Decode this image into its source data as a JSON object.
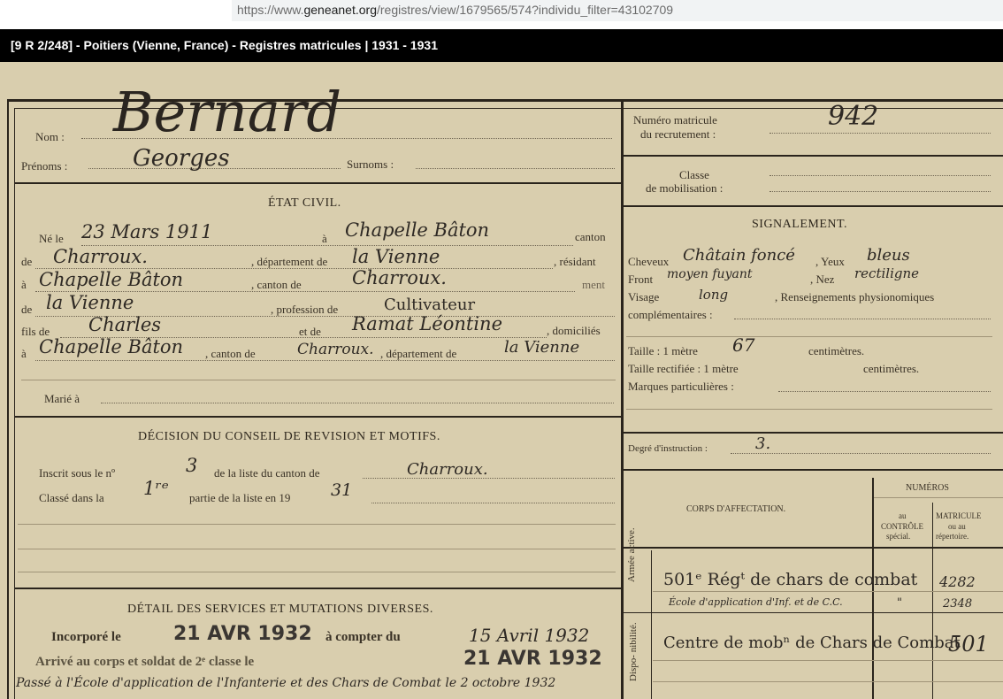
{
  "browser": {
    "url_prefix": "https://www.",
    "url_domain": "geneanet.org",
    "url_path": "/registres/view/1679565/574?individu_filter=43102709"
  },
  "viewer": {
    "title": "[9 R 2/248] - Poitiers (Vienne, France) - Registres matricules | 1931 - 1931"
  },
  "record": {
    "labels": {
      "nom": "Nom :",
      "prenoms": "Prénoms :",
      "surnoms": "Surnoms :",
      "etat_civil": "ÉTAT CIVIL.",
      "ne_le": "Né le",
      "a": "à",
      "canton": "canton",
      "de": "de",
      "departement_de": ", département de",
      "residant": ", résidant",
      "a2": "à",
      "canton_de": ", canton de",
      "ment": "ment",
      "de2": "de",
      "profession_de": ", profession de",
      "fils_de": "fils de",
      "et_de": "et de",
      "domicilies": ", domiciliés",
      "a3": "à",
      "canton_de2": ", canton de",
      "departement_de2": ", département de",
      "marie_a": "Marié à",
      "decision": "DÉCISION  DU CONSEIL DE REVISION ET MOTIFS.",
      "inscrit": "Inscrit sous le nº",
      "de_la_liste": "de la liste du canton de",
      "classe_dans": "Classé dans   la",
      "partie": "partie de la liste en 19",
      "detail": "DÉTAIL DES SERVICES ET MUTATIONS DIVERSES.",
      "incorpore": "Incorporé le",
      "a_compter": "à  compter  du",
      "arrive": "Arrivé au corps et soldat de 2ᵉ classe le",
      "numero_matricule": "Numéro matricule",
      "du_recrutement": "du recrutement :",
      "classe": "Classe",
      "de_mobilisation": "de mobilisation :",
      "signalement": "SIGNALEMENT.",
      "cheveux": "Cheveux",
      "yeux": ", Yeux",
      "front": "Front",
      "nez": ", Nez",
      "visage": "Visage",
      "renseignements": ", Renseignements physionomiques",
      "complementaires": "complémentaires :",
      "taille": "Taille : 1 mètre",
      "centimetres": "centimètres.",
      "taille_rectifiee": "Taille rectifiée : 1 mètre",
      "centimetres2": "centimètres.",
      "marques": "Marques particulières :",
      "degre": "Degré d'instruction :",
      "numeros": "NUMÉROS",
      "corps": "CORPS D'AFFECTATION.",
      "au_controle": [
        "au",
        "CONTRÔLE",
        "spécial."
      ],
      "matricule_rep": [
        "MATRICULE",
        "ou au",
        "répertoire."
      ],
      "armee_active": "Armée active.",
      "disponibilite": "Dispo- nibilité."
    },
    "values": {
      "nom": "Bernard",
      "prenoms": "Georges",
      "date_naissance": "23 Mars 1911",
      "lieu_naissance": "Chapelle Bâton",
      "canton": "Charroux.",
      "departement": "la Vienne",
      "residence": "Chapelle Bâton",
      "canton_residence": "Charroux.",
      "departement_residence": "la Vienne",
      "profession": "Cultivateur",
      "pere": "Charles",
      "mere": "Ramat Léontine",
      "domicile": "Chapelle Bâton",
      "canton_domicile": "Charroux.",
      "departement_domicile": "la Vienne",
      "inscrit_numero": "3",
      "inscrit_canton": "Charroux.",
      "partie": "1ʳᵉ",
      "annee_liste": "31",
      "incorpore_le": "21 AVR 1932",
      "a_compter_du": "15 Avril 1932",
      "arrive_le": "21 AVR 1932",
      "passe": "Passé à l'École d'application de l'Infanterie et des Chars de Combat le 2 octobre 1932",
      "numero_matricule": "942",
      "cheveux": "Châtain foncé",
      "yeux": "bleus",
      "front": "moyen fuyant",
      "nez": "rectiligne",
      "visage": "long",
      "taille_cm": "67",
      "degre_instruction": "3.",
      "corps_1": "501ᵉ Régᵗ de chars de combat",
      "corps_2": "École d'application d'Inf. et de C.C.",
      "corps_3": "Centre de mobⁿ de Chars de Combat",
      "controle_1": "4282",
      "controle_2": "2348",
      "controle_2_mark": "\"",
      "controle_3": "501"
    }
  }
}
